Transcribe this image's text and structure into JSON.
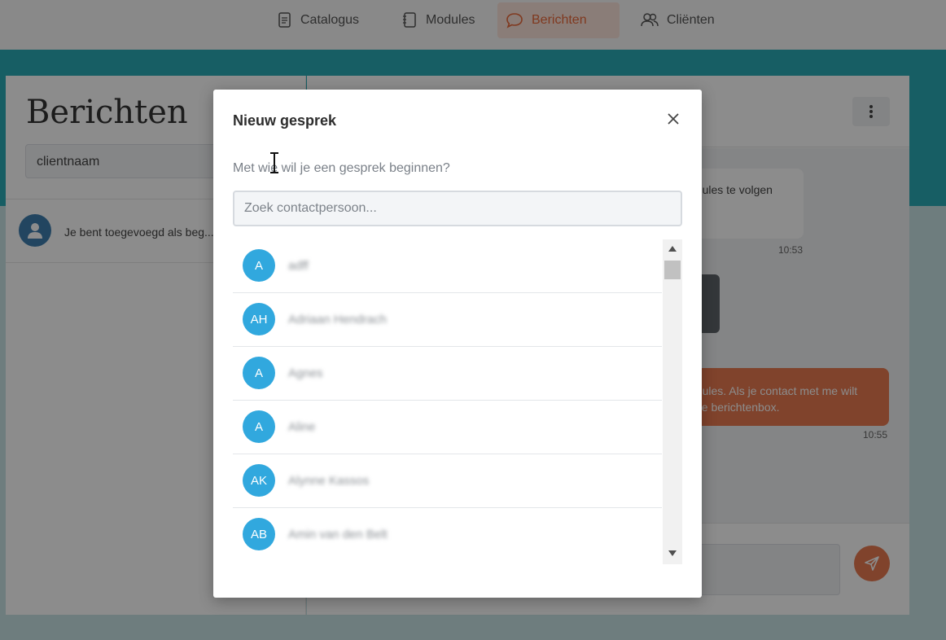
{
  "nav": {
    "items": [
      {
        "label": "Catalogus",
        "icon": "document-icon"
      },
      {
        "label": "Modules",
        "icon": "notebook-icon"
      },
      {
        "label": "Berichten",
        "icon": "chat-bubble-icon",
        "active": true
      },
      {
        "label": "Cliënten",
        "icon": "users-icon"
      }
    ]
  },
  "sidebar": {
    "title": "Berichten",
    "search_value": "clientnaam",
    "conversations": [
      {
        "preview": "Je bent toegevoegd als beg..."
      }
    ]
  },
  "chat": {
    "messages": [
      {
        "text": "odules te volgen",
        "time": "10:53"
      },
      {
        "text_line1": "odules. Als je contact met me wilt",
        "text_line2": "eze berichtenbox.",
        "time": "10:55"
      }
    ]
  },
  "modal": {
    "title": "Nieuw gesprek",
    "subtitle": "Met wie wil je een gesprek beginnen?",
    "search_placeholder": "Zoek contactpersoon...",
    "contacts": [
      {
        "initials": "A",
        "name": "adff"
      },
      {
        "initials": "AH",
        "name": "Adriaan Hendrach"
      },
      {
        "initials": "A",
        "name": "Agnes"
      },
      {
        "initials": "A",
        "name": "Aline"
      },
      {
        "initials": "AK",
        "name": "Alynne Kassos"
      },
      {
        "initials": "AB",
        "name": "Amin van den Belt"
      }
    ]
  },
  "colors": {
    "accent": "#e9683a",
    "teal": "#2aacb6",
    "avatar": "#31a8de"
  }
}
